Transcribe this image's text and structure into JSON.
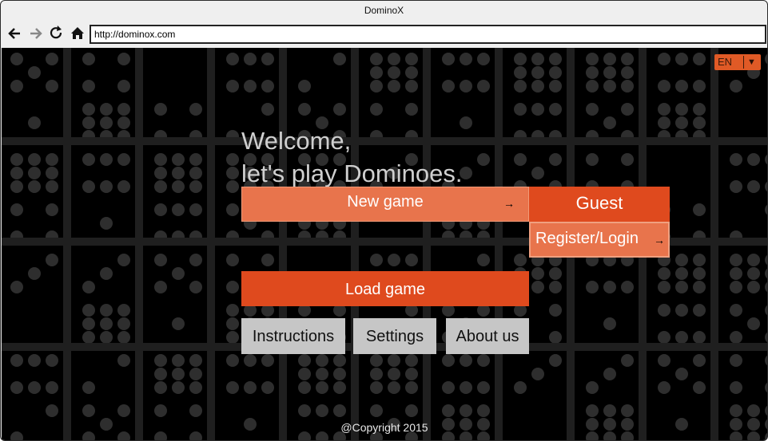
{
  "window": {
    "title": "DominoX"
  },
  "toolbar": {
    "back_icon": "arrow-left-icon",
    "forward_icon": "arrow-right-icon",
    "reload_icon": "reload-icon",
    "home_icon": "home-icon",
    "url": "http://dominox.com"
  },
  "lang": {
    "label": "EN",
    "arrow": "▼"
  },
  "welcome": {
    "line1": "Welcome,",
    "line2": "let's play Dominoes."
  },
  "buttons": {
    "new_game": "New game",
    "guest": "Guest",
    "register": "Register/Login",
    "load_game": "Load game",
    "instructions": "Instructions",
    "settings": "Settings",
    "about": "About us",
    "arrow": "→"
  },
  "footer": {
    "copyright": "@Copyright 2015"
  },
  "colors": {
    "accent": "#df4a1e",
    "accent_light": "#e8744c",
    "grey_button": "#c6c6c6",
    "background": "#000000",
    "pip": "#2e2e2e",
    "grid_line": "#1f1f1f"
  }
}
